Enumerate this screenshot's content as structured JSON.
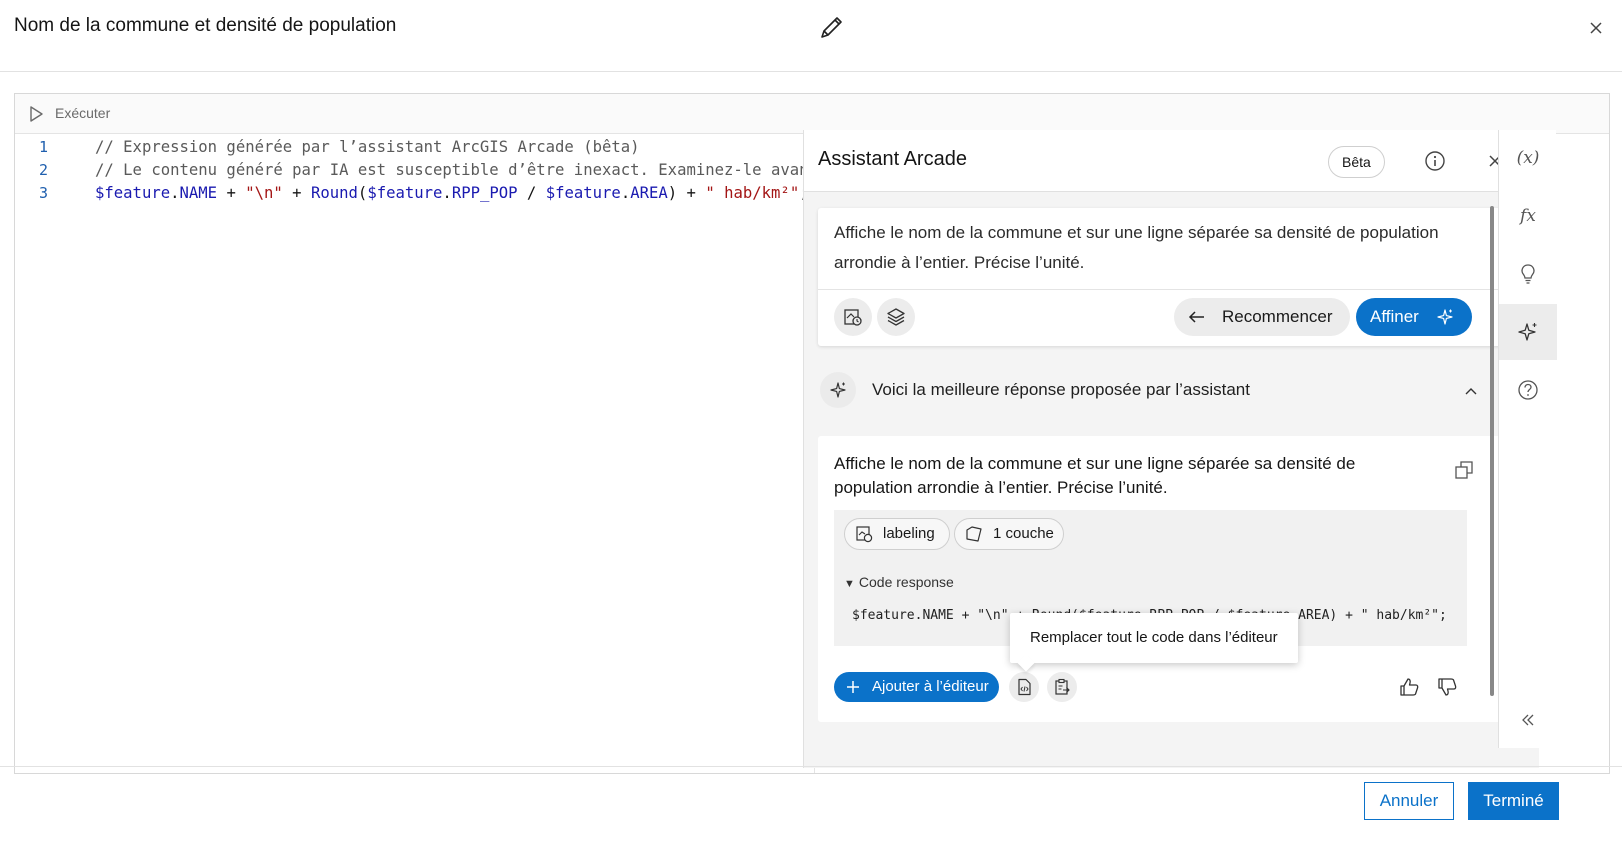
{
  "header": {
    "title": "Nom de la commune et densité de population"
  },
  "toolbar": {
    "run_label": "Exécuter"
  },
  "editor": {
    "lines": [
      {
        "number": "1",
        "tokens": [
          {
            "t": "cm",
            "v": "// Expression générée par l’assistant ArcGIS Arcade (bêta)"
          }
        ]
      },
      {
        "number": "2",
        "tokens": [
          {
            "t": "cm",
            "v": "// Le contenu généré par IA est susceptible d’être inexact. Examinez-le avant"
          }
        ]
      },
      {
        "number": "3",
        "tokens": [
          {
            "t": "kw",
            "v": "$feature"
          },
          {
            "t": "op",
            "v": "."
          },
          {
            "t": "kw",
            "v": "NAME"
          },
          {
            "t": "op",
            "v": " + "
          },
          {
            "t": "st",
            "v": "\"\\n\""
          },
          {
            "t": "op",
            "v": " + "
          },
          {
            "t": "kw",
            "v": "Round"
          },
          {
            "t": "op",
            "v": "("
          },
          {
            "t": "kw",
            "v": "$feature"
          },
          {
            "t": "op",
            "v": "."
          },
          {
            "t": "kw",
            "v": "RPP_POP"
          },
          {
            "t": "op",
            "v": " / "
          },
          {
            "t": "kw",
            "v": "$feature"
          },
          {
            "t": "op",
            "v": "."
          },
          {
            "t": "kw",
            "v": "AREA"
          },
          {
            "t": "op",
            "v": ") + "
          },
          {
            "t": "st",
            "v": "\" hab/km²\""
          },
          {
            "t": "op",
            "v": ";"
          }
        ]
      }
    ]
  },
  "assistant": {
    "title": "Assistant Arcade",
    "beta_label": "Bêta",
    "prompt_text": "Affiche le nom de la commune et sur une ligne séparée sa densité de population arrondie à l’entier. Précise l’unité.",
    "restart_label": "Recommencer",
    "refine_label": "Affiner",
    "best_response_label": "Voici la meilleure réponse proposée par l’assistant",
    "response": {
      "text": "Affiche le nom de la commune et sur une ligne séparée sa densité de population arrondie à l’entier. Précise l’unité.",
      "profile_pill": "labeling",
      "layers_pill": "1 couche",
      "code_summary": "Code response",
      "code": "$feature.NAME + \"\\n\" + Round($feature.RPP_POP / $feature.AREA) + \" hab/km²\";",
      "add_to_editor_label": "Ajouter à l’éditeur",
      "tooltip": "Remplacer tout le code dans l’éditeur"
    }
  },
  "rail": {
    "variables_label": "(x)",
    "functions_label": "fx"
  },
  "footer": {
    "cancel_label": "Annuler",
    "done_label": "Terminé"
  },
  "colors": {
    "accent": "#0b72c9",
    "comment": "#5a5a5a",
    "keyword": "#1a1ab0",
    "string": "#a31515",
    "line_number": "#1f5fae"
  }
}
